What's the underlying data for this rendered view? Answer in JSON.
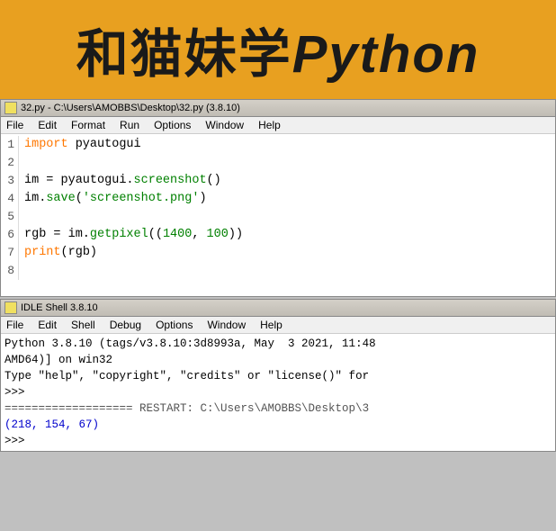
{
  "banner": {
    "title_cn": "和猫妹学",
    "title_en": "Python"
  },
  "editor": {
    "title": "32.py - C:\\Users\\AMOBBS\\Desktop\\32.py (3.8.10)",
    "menu": [
      "File",
      "Edit",
      "Format",
      "Run",
      "Options",
      "Window",
      "Help"
    ],
    "lines": [
      {
        "num": 1,
        "code": "import pyautogui"
      },
      {
        "num": 2,
        "code": ""
      },
      {
        "num": 3,
        "code": "im = pyautogui.screenshot()"
      },
      {
        "num": 4,
        "code": "im.save('screenshot.png')"
      },
      {
        "num": 5,
        "code": ""
      },
      {
        "num": 6,
        "code": "rgb = im.getpixel((1400, 100))"
      },
      {
        "num": 7,
        "code": "print(rgb)"
      },
      {
        "num": 8,
        "code": ""
      }
    ]
  },
  "shell": {
    "title": "IDLE Shell 3.8.10",
    "menu": [
      "File",
      "Edit",
      "Shell",
      "Debug",
      "Options",
      "Window",
      "Help"
    ],
    "lines": [
      "Python 3.8.10 (tags/v3.8.10:3d8993a, May  3 2021, 11:48",
      "AMD64)] on win32",
      "Type \"help\", \"copyright\", \"credits\" or \"license()\" for",
      ">>> ",
      "=================== RESTART: C:\\Users\\AMOBBS\\Desktop\\3",
      "(218, 154, 67)",
      ">>> "
    ]
  }
}
